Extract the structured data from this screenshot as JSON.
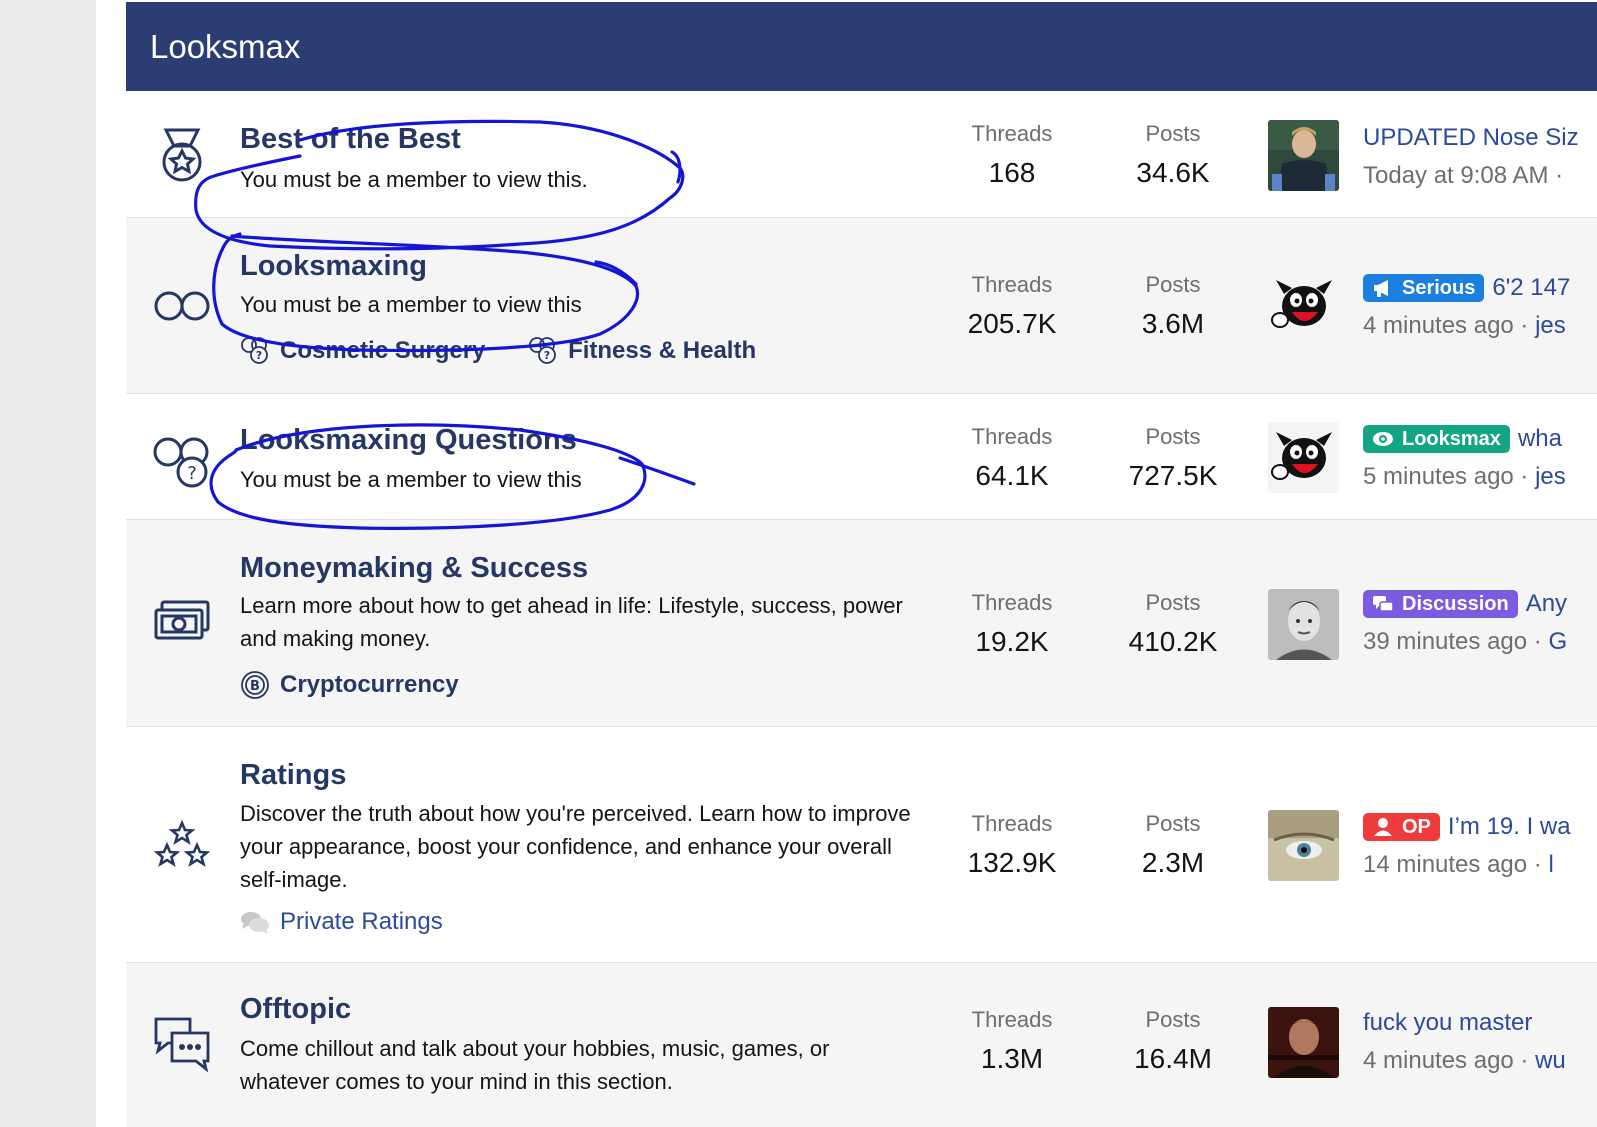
{
  "category": {
    "title": "Looksmax"
  },
  "labels": {
    "threads": "Threads",
    "posts": "Posts",
    "dot": " · "
  },
  "colors": {
    "header_bg": "#2b3d72",
    "link": "#2b4a9a",
    "serious": "#1b7fe0",
    "looksmax": "#14a585",
    "discussion": "#7b5be0",
    "op": "#ef3b3b",
    "annotation_ink": "#1515d6"
  },
  "nodes": [
    {
      "icon": "medal-icon",
      "title": "Best of the Best",
      "description": "You must be a member to view this.",
      "threads": "168",
      "posts": "34.6K",
      "last_post": {
        "prefix": "",
        "title": "UPDATED Nose Siz",
        "time": "Today at 9:08 AM",
        "user": ""
      }
    },
    {
      "icon": "infinity-icon",
      "title": "Looksmaxing",
      "description": "You must be a member to view this",
      "subforums": [
        {
          "icon": "subforum-icon",
          "label": "Cosmetic Surgery"
        },
        {
          "icon": "subforum-icon",
          "label": "Fitness & Health"
        }
      ],
      "threads": "205.7K",
      "posts": "3.6M",
      "last_post": {
        "prefix": "Serious",
        "prefix_icon": "megaphone-icon",
        "title": "6'2 147",
        "time": "4 minutes ago",
        "user": "jes"
      }
    },
    {
      "icon": "question-circles-icon",
      "title": "Looksmaxing Questions",
      "description": "You must be a member to view this",
      "threads": "64.1K",
      "posts": "727.5K",
      "last_post": {
        "prefix": "Looksmax",
        "prefix_icon": "eye-icon",
        "title": "wha",
        "time": "5 minutes ago",
        "user": "jes"
      }
    },
    {
      "icon": "money-icon",
      "title": "Moneymaking & Success",
      "description": "Learn more about how to get ahead in life: Lifestyle, success, power and making money.",
      "subforums": [
        {
          "icon": "bitcoin-icon",
          "label": "Cryptocurrency"
        }
      ],
      "threads": "19.2K",
      "posts": "410.2K",
      "last_post": {
        "prefix": "Discussion",
        "prefix_icon": "chat-icon",
        "title": "Any",
        "time": "39 minutes ago",
        "user": "G"
      }
    },
    {
      "icon": "stars-icon",
      "title": "Ratings",
      "description": "Discover the truth about how you're perceived. Learn how to improve your appearance, boost your confidence, and enhance your overall self-image.",
      "subforums": [
        {
          "icon": "comments-icon",
          "label": "Private Ratings"
        }
      ],
      "threads": "132.9K",
      "posts": "2.3M",
      "last_post": {
        "prefix": "OP",
        "prefix_icon": "user-icon",
        "title": "I’m 19. I wa",
        "time": "14 minutes ago",
        "user": "l"
      }
    },
    {
      "icon": "chat-bubbles-icon",
      "title": "Offtopic",
      "description": "Come chillout and talk about your hobbies, music, games, or whatever comes to your mind in this section.",
      "threads": "1.3M",
      "posts": "16.4M",
      "last_post": {
        "prefix": "",
        "title": "fuck you master",
        "time": "4 minutes ago",
        "user": "wu"
      }
    }
  ]
}
